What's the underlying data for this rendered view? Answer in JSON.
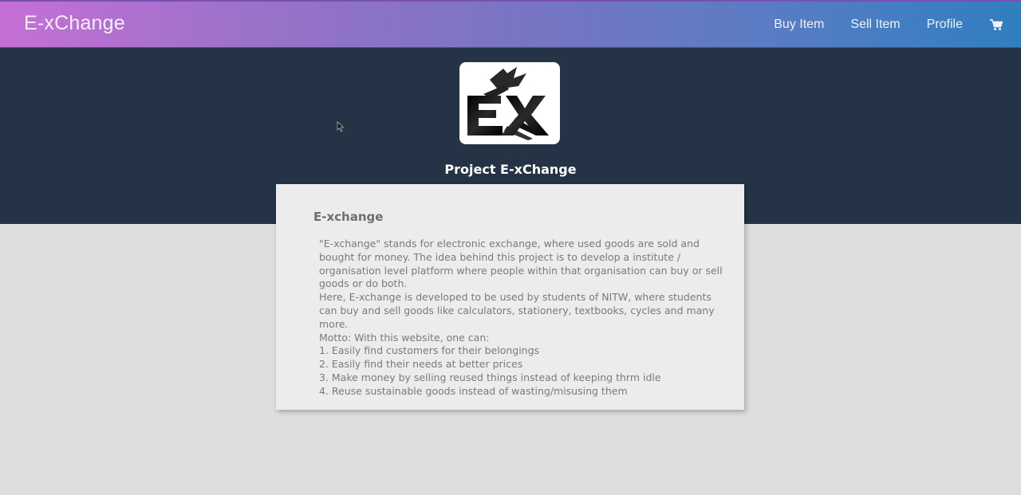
{
  "navbar": {
    "brand": "E-xChange",
    "links": [
      "Buy Item",
      "Sell Item",
      "Profile"
    ],
    "cart_icon": "shopping-cart-icon",
    "gradient_start": "#c56fd6",
    "gradient_end": "#2f7fbf"
  },
  "hero": {
    "logo_text": "EX",
    "title": "Project E-xChange",
    "background": "#243446"
  },
  "card": {
    "title": "E-xchange",
    "paragraphs": [
      "\"E-xchange\" stands for electronic exchange, where used goods are sold and bought for money. The idea behind this project is to develop a institute / organisation level platform where people within that organisation can buy or sell goods or do both.",
      "Here, E-xchange is developed to be used by students of NITW, where students can buy and sell goods like calculators, stationery, textbooks, cycles and many more.",
      "Motto: With this website, one can:",
      "1. Easily find customers for their belongings",
      "2. Easily find their needs at better prices",
      "3. Make money by selling reused things instead of keeping thrm idle",
      "4. Reuse sustainable goods instead of wasting/misusing them"
    ]
  }
}
